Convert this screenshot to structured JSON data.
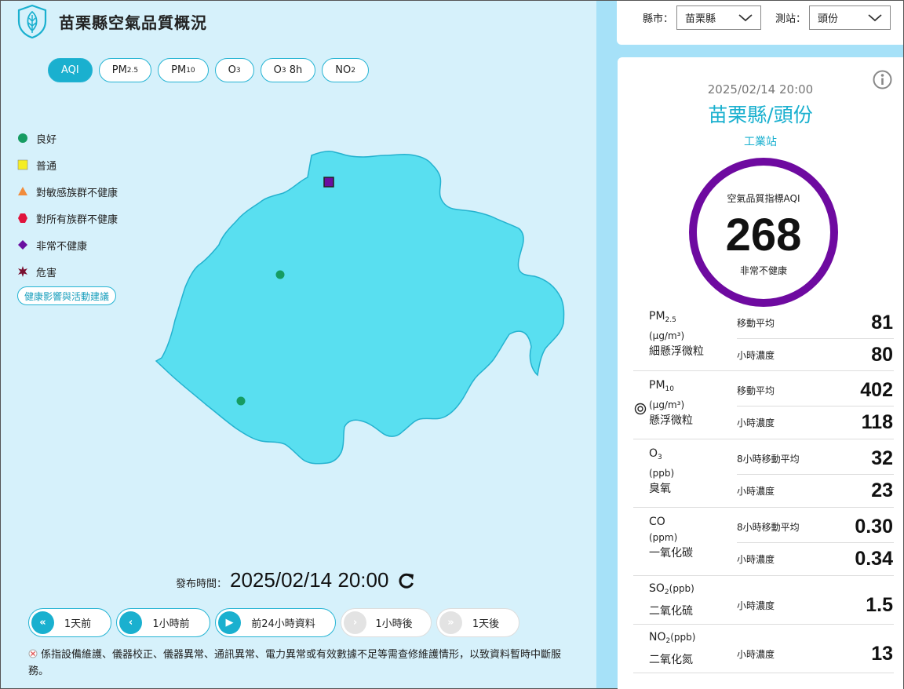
{
  "header": {
    "title": "苗栗縣空氣品質概況"
  },
  "tabs": [
    {
      "label": "AQI",
      "sub": "",
      "suffix": "",
      "active": true
    },
    {
      "label": "PM",
      "sub": "2.5",
      "suffix": "",
      "active": false
    },
    {
      "label": "PM",
      "sub": "10",
      "suffix": "",
      "active": false
    },
    {
      "label": "O",
      "sub": "3",
      "suffix": "",
      "active": false
    },
    {
      "label": "O",
      "sub": "3",
      "suffix": " 8h",
      "active": false
    },
    {
      "label": "NO",
      "sub": "2",
      "suffix": "",
      "active": false
    }
  ],
  "legend": [
    {
      "label": "良好",
      "shape": "circle",
      "color": "#169c62"
    },
    {
      "label": "普通",
      "shape": "square",
      "color": "#f5ee24"
    },
    {
      "label": "對敏感族群不健康",
      "shape": "triangle",
      "color": "#f18c3c"
    },
    {
      "label": "對所有族群不健康",
      "shape": "hexagon",
      "color": "#e0143c"
    },
    {
      "label": "非常不健康",
      "shape": "diamond",
      "color": "#6a0fa0"
    },
    {
      "label": "危害",
      "shape": "star",
      "color": "#7a1030"
    }
  ],
  "health_button": "健康影響與活動建議",
  "publish": {
    "label": "發布時間：",
    "time": "2025/02/14 20:00"
  },
  "time_nav": [
    {
      "label": "1天前",
      "icon": "«",
      "disabled": false,
      "name": "prev-day-button"
    },
    {
      "label": "1小時前",
      "icon": "‹",
      "disabled": false,
      "name": "prev-hour-button"
    },
    {
      "label": "前24小時資料",
      "icon": "▶",
      "disabled": false,
      "name": "play-24h-button"
    },
    {
      "label": "1小時後",
      "icon": "›",
      "disabled": true,
      "name": "next-hour-button"
    },
    {
      "label": "1天後",
      "icon": "»",
      "disabled": true,
      "name": "next-day-button"
    }
  ],
  "note": "係指設備維護、儀器校正、儀器異常、通訊異常、電力異常或有效數據不足等需查修維護情形，以致資料暫時中斷服務。",
  "selectors": {
    "county_label": "縣市：",
    "county_value": "苗栗縣",
    "station_label": "測站：",
    "station_value": "頭份"
  },
  "station": {
    "time": "2025/02/14 20:00",
    "place": "苗栗縣/頭份",
    "type": "工業站",
    "aqi_label": "空氣品質指標AQI",
    "aqi_value": "268",
    "aqi_status": "非常不健康",
    "aqi_color": "#6e0aa0"
  },
  "pollutants": [
    {
      "name": "PM",
      "sub": "2.5",
      "unit_html": "(μg/m³)",
      "desc": "細懸浮微粒",
      "rows": [
        {
          "k": "移動平均",
          "v": "81"
        },
        {
          "k": "小時濃度",
          "v": "80"
        }
      ]
    },
    {
      "name": "PM",
      "sub": "10",
      "unit_html": "(μg/m³)",
      "desc": "懸浮微粒",
      "main": true,
      "rows": [
        {
          "k": "移動平均",
          "v": "402"
        },
        {
          "k": "小時濃度",
          "v": "118"
        }
      ]
    },
    {
      "name": "O",
      "sub": "3",
      "unit_html": "(ppb)",
      "desc": "臭氧",
      "rows": [
        {
          "k": "8小時移動平均",
          "v": "32"
        },
        {
          "k": "小時濃度",
          "v": "23"
        }
      ]
    },
    {
      "name": "CO",
      "sub": "",
      "unit_html": "(ppm)",
      "desc": "一氧化碳",
      "rows": [
        {
          "k": "8小時移動平均",
          "v": "0.30"
        },
        {
          "k": "小時濃度",
          "v": "0.34"
        }
      ]
    },
    {
      "name": "SO",
      "sub": "2",
      "unit_html": "(ppb)",
      "desc": "二氧化硫",
      "inline_unit": true,
      "rows": [
        {
          "k": "小時濃度",
          "v": "1.5"
        }
      ]
    },
    {
      "name": "NO",
      "sub": "2",
      "unit_html": "(ppb)",
      "desc": "二氧化氮",
      "inline_unit": true,
      "rows": [
        {
          "k": "小時濃度",
          "v": "13"
        }
      ]
    }
  ],
  "map_stations": [
    {
      "name": "map-station-marker-toufen",
      "status": "非常不健康"
    },
    {
      "name": "map-station-marker-miaoli",
      "status": "良好"
    },
    {
      "name": "map-station-marker-sanyi",
      "status": "良好"
    }
  ]
}
